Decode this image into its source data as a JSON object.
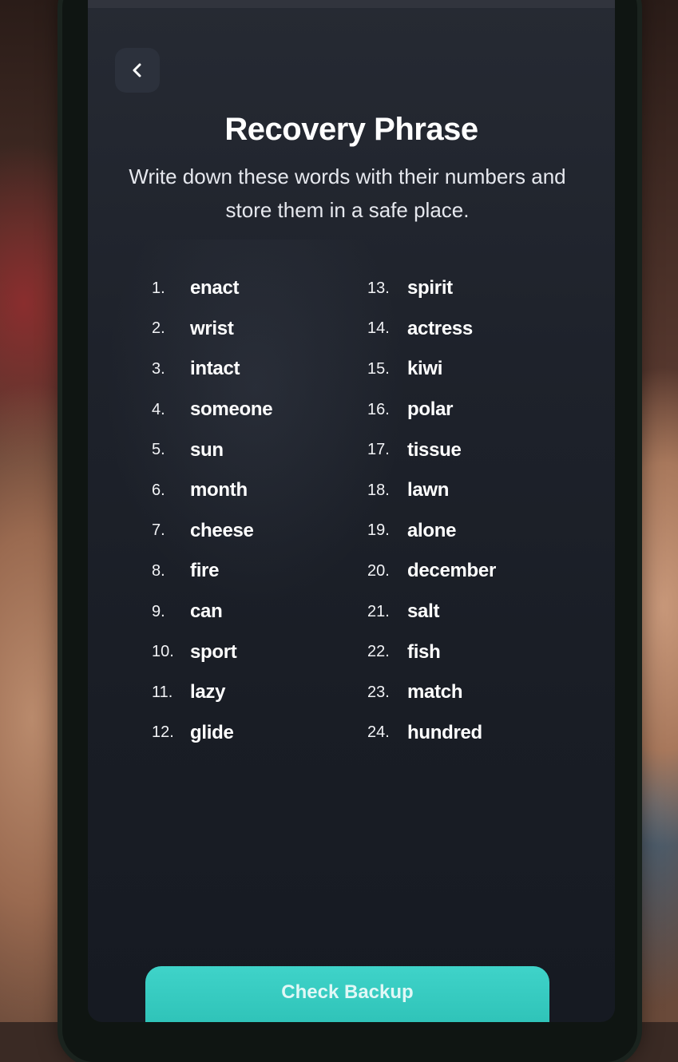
{
  "header": {
    "back_icon": "chevron-left-icon"
  },
  "title": "Recovery Phrase",
  "subtitle": "Write down these words with their numbers and store them in a safe place.",
  "words_left": [
    {
      "num": "1.",
      "word": "enact"
    },
    {
      "num": "2.",
      "word": "wrist"
    },
    {
      "num": "3.",
      "word": "intact"
    },
    {
      "num": "4.",
      "word": "someone"
    },
    {
      "num": "5.",
      "word": "sun"
    },
    {
      "num": "6.",
      "word": "month"
    },
    {
      "num": "7.",
      "word": "cheese"
    },
    {
      "num": "8.",
      "word": "fire"
    },
    {
      "num": "9.",
      "word": "can"
    },
    {
      "num": "10.",
      "word": "sport"
    },
    {
      "num": "11.",
      "word": "lazy"
    },
    {
      "num": "12.",
      "word": "glide"
    }
  ],
  "words_right": [
    {
      "num": "13.",
      "word": "spirit"
    },
    {
      "num": "14.",
      "word": "actress"
    },
    {
      "num": "15.",
      "word": "kiwi"
    },
    {
      "num": "16.",
      "word": "polar"
    },
    {
      "num": "17.",
      "word": "tissue"
    },
    {
      "num": "18.",
      "word": "lawn"
    },
    {
      "num": "19.",
      "word": "alone"
    },
    {
      "num": "20.",
      "word": "december"
    },
    {
      "num": "21.",
      "word": "salt"
    },
    {
      "num": "22.",
      "word": "fish"
    },
    {
      "num": "23.",
      "word": "match"
    },
    {
      "num": "24.",
      "word": "hundred"
    }
  ],
  "cta": {
    "label": "Check Backup"
  },
  "colors": {
    "accent": "#2bbfb4",
    "background": "#1e222b",
    "text": "#ffffff"
  }
}
